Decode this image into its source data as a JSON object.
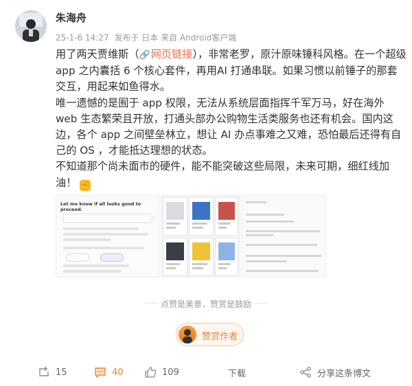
{
  "post": {
    "author": "朱海舟",
    "time": "25-1-6 14:27",
    "source": "发布于 日本 来自 Android客户端",
    "paragraphs": [
      {
        "pre": "用了两天贾维斯（",
        "link": "网页链接",
        "post": "），非常老罗，原汁原味锤科风格。在一个超级app 之内囊括 6 个核心套件，再用AI 打通串联。如果习惯以前锤子的那套交互，用起来如鱼得水。"
      },
      {
        "text": "唯一遗憾的是囿于 app 权限，无法从系统层面指挥千军万马，好在海外 web 生态繁荣且开放，打通头部办公购物生活类服务也还有机会。国内这边，各个 app 之间壁垒林立，想让 AI 办点事难之又难，恐怕最后还得有自己的 OS ，才能抵达理想的状态。"
      },
      {
        "text": "不知道那个尚未面市的硬件，能不能突破这些局限，未来可期，细红线加油！"
      }
    ],
    "link_icon": "link-icon",
    "emoji": "muscle-emoji",
    "images": [
      {
        "title": "Let me know if all looks good to proceed."
      },
      {},
      {}
    ]
  },
  "divider": {
    "text": "点赞是美意，赞赏是鼓励"
  },
  "reward": {
    "label": "赞赏作者"
  },
  "footer": {
    "repost": {
      "icon": "repost-icon",
      "count": "15"
    },
    "comment": {
      "icon": "comment-icon",
      "count": "40"
    },
    "like": {
      "icon": "like-icon",
      "count": "109"
    },
    "download": {
      "label": "下载"
    },
    "share": {
      "icon": "share-icon",
      "label": "分享这条博文"
    }
  },
  "colors": {
    "accent": "#eb7350",
    "reward": "#e08a3a",
    "active": "#e8833a"
  }
}
